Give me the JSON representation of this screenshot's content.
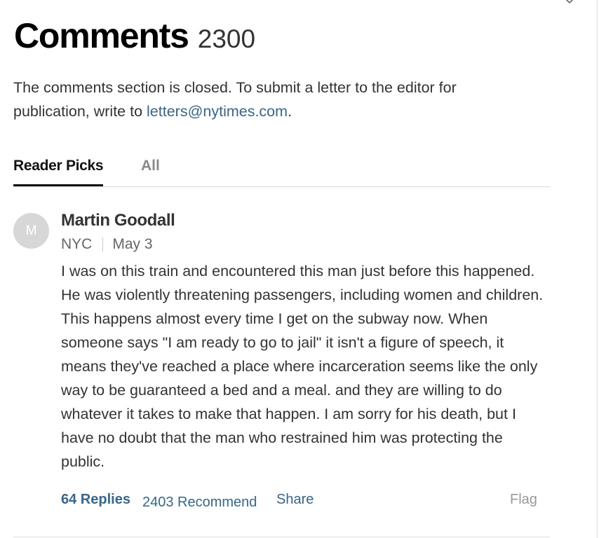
{
  "header": {
    "title": "Comments",
    "count": "2300"
  },
  "notice": {
    "text_before": "The comments section is closed. To submit a letter to the editor for publication, write to ",
    "email_link": "letters@nytimes.com",
    "text_after": "."
  },
  "tabs": [
    {
      "label": "Reader Picks",
      "active": true
    },
    {
      "label": "All",
      "active": false
    }
  ],
  "comment": {
    "avatar_initial": "M",
    "author": "Martin Goodall",
    "location": "NYC",
    "date": "May 3",
    "text": "I was on this train and encountered this man just before this happened. He was violently threatening passengers, including women and children. This happens almost every time I get on the subway now. When someone says \"I am ready to go to jail\" it isn't a figure of speech, it means they've reached a place where incarceration seems like the only way to be guaranteed a bed and a meal. and they are willing to do whatever it takes to make that happen. I am sorry for his death, but I have no doubt that the man who restrained him was protecting the public.",
    "actions": {
      "replies": "64 Replies",
      "recommend": "2403 Recommend",
      "share": "Share",
      "flag": "Flag"
    }
  },
  "colors": {
    "link": "#326891",
    "text": "#333333",
    "muted": "#666666",
    "avatar_bg": "#d7d7d7"
  },
  "icons": {
    "close": "close-icon"
  }
}
